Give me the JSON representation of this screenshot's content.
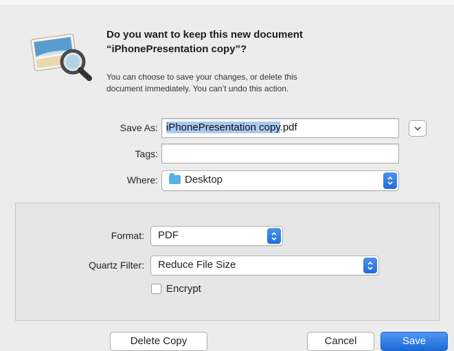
{
  "dialog": {
    "title_line1": "Do you want to keep this new document",
    "title_line2": "“iPhonePresentation copy”?",
    "message_line1": "You can choose to save your changes, or delete this",
    "message_line2": "document immediately. You can’t undo this action."
  },
  "save_as": {
    "label": "Save As:",
    "selected_part": "iPhonePresentation copy",
    "extension": ".pdf"
  },
  "tags": {
    "label": "Tags:",
    "value": ""
  },
  "where": {
    "label": "Where:",
    "value": "Desktop"
  },
  "format": {
    "label": "Format:",
    "value": "PDF"
  },
  "quartz_filter": {
    "label": "Quartz Filter:",
    "value": "Reduce File Size"
  },
  "encrypt": {
    "label": "Encrypt",
    "checked": false
  },
  "buttons": {
    "delete": "Delete Copy",
    "cancel": "Cancel",
    "save": "Save"
  },
  "colors": {
    "accent": "#1f6dd8",
    "selection": "#a9c9ef",
    "folder": "#57b0e6"
  },
  "icons": {
    "app": "preview-app-icon",
    "expand": "chevron-down-icon",
    "popup": "updown-arrows-icon",
    "folder": "folder-icon"
  }
}
